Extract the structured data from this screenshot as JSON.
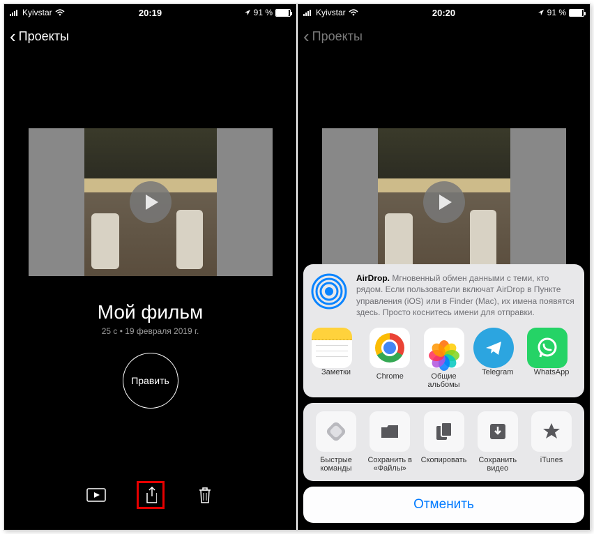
{
  "left": {
    "status": {
      "carrier": "Kyivstar",
      "time": "20:19",
      "battery": "91 %"
    },
    "nav_back": "Проекты",
    "project": {
      "title": "Мой фильм",
      "meta": "25 с • 19 февраля 2019 г.",
      "edit": "Править"
    }
  },
  "right": {
    "status": {
      "carrier": "Kyivstar",
      "time": "20:20",
      "battery": "91 %"
    },
    "nav_back": "Проекты",
    "airdrop": {
      "bold": "AirDrop.",
      "text": "Мгновенный обмен данными с теми, кто рядом. Если пользователи включат AirDrop в Пункте управления (iOS) или в Finder (Mac), их имена появятся здесь. Просто коснитесь имени для отправки."
    },
    "apps": [
      {
        "label": "Заметки"
      },
      {
        "label": "Chrome"
      },
      {
        "label": "Общие альбомы"
      },
      {
        "label": "Telegram"
      },
      {
        "label": "WhatsApp"
      }
    ],
    "actions": [
      {
        "label": "Быстрые команды"
      },
      {
        "label": "Сохранить в «Файлы»"
      },
      {
        "label": "Скопировать"
      },
      {
        "label": "Сохранить видео"
      },
      {
        "label": "iTunes"
      }
    ],
    "cancel": "Отменить"
  }
}
